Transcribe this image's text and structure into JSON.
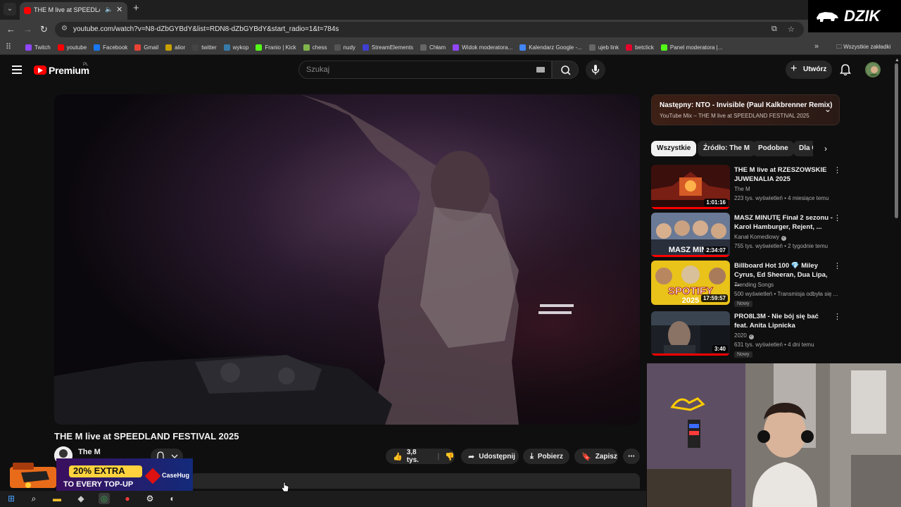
{
  "browser": {
    "tab_title": "THE M live at SPEEDLAND F",
    "url": "youtube.com/watch?v=N8-dZbGYBdY&list=RDN8-dZbGYBdY&start_radio=1&t=784s",
    "bookmarks": [
      {
        "label": "Twitch",
        "icon": "twitch-icon",
        "color": "#9146ff"
      },
      {
        "label": "youtube",
        "icon": "youtube-icon",
        "color": "#ff0000"
      },
      {
        "label": "Facebook",
        "icon": "facebook-icon",
        "color": "#1877f2"
      },
      {
        "label": "Gmail",
        "icon": "gmail-icon",
        "color": "#ea4335"
      },
      {
        "label": "alior",
        "icon": "alior-icon",
        "color": "#c8a000"
      },
      {
        "label": "twitter",
        "icon": "x-icon",
        "color": "#444444"
      },
      {
        "label": "wykop",
        "icon": "wykop-icon",
        "color": "#367aa9"
      },
      {
        "label": "Franio | Kick",
        "icon": "kick-icon",
        "color": "#53fc18"
      },
      {
        "label": "chess",
        "icon": "chess-icon",
        "color": "#81b64c"
      },
      {
        "label": "nudy",
        "icon": "folder-icon",
        "color": "#555555"
      },
      {
        "label": "StreamElements",
        "icon": "streamelements-icon",
        "color": "#3f3fd1"
      },
      {
        "label": "Chłam",
        "icon": "globe-icon",
        "color": "#666666"
      },
      {
        "label": "Widok moderatora...",
        "icon": "twitch-icon",
        "color": "#9146ff"
      },
      {
        "label": "Kalendarz Google -...",
        "icon": "calendar-icon",
        "color": "#4285f4"
      },
      {
        "label": "ujeb link",
        "icon": "globe-icon",
        "color": "#666666"
      },
      {
        "label": "betclick",
        "icon": "betclic-icon",
        "color": "#e5002b"
      },
      {
        "label": "Panel moderatora |...",
        "icon": "kick-icon",
        "color": "#53fc18"
      }
    ],
    "all_bookmarks": "Wszystkie zakładki"
  },
  "overlay_logo": "DZIK",
  "youtube": {
    "brand": "Premium",
    "country": "PL",
    "search_placeholder": "Szukaj",
    "create_label": "Utwórz"
  },
  "video": {
    "title": "THE M live at SPEEDLAND FESTIVAL 2025",
    "channel": "The M",
    "likes": "3,8 tys.",
    "share": "Udostępnij",
    "download": "Pobierz",
    "save": "Zapisz"
  },
  "up_next": {
    "title": "Następny: NTO - Invisible (Paul Kalkbrenner Remix)",
    "subtitle": "YouTube Mix – THE M live at SPEEDLAND FESTIVAL 2025"
  },
  "chips": [
    "Wszystkie",
    "Źródło: The M",
    "Podobne",
    "Dla C"
  ],
  "recommendations": [
    {
      "title": "THE M live at RZESZOWSKIE JUWENALIA 2025",
      "channel": "The M",
      "meta": "223 tys. wyświetleń • 4 miesiące temu",
      "duration": "1:01:16",
      "badge": "",
      "progress": 1.0,
      "verified": false
    },
    {
      "title": "MASZ MINUTĘ Finał 2 sezonu - Karol Hamburger, Rejent, ...",
      "channel": "Kanał Komediowy",
      "meta": "755 tys. wyświetleń • 2 tygodnie temu",
      "duration": "2:34:07",
      "badge": "",
      "progress": 1.0,
      "verified": true
    },
    {
      "title": "Billboard Hot 100 💎 Miley Cyrus, Ed Sheeran, Dua Lipa, ...",
      "channel": "Trending Songs",
      "meta": "500 wyświetleń • Transmisja odbyła się ...",
      "duration": "17:59:57",
      "badge": "Nowy",
      "progress": 0.0,
      "verified": false
    },
    {
      "title": "PRO8L3M - Nie bój się bać feat. Anita Lipnicka",
      "channel": "2020",
      "meta": "631 tys. wyświetleń • 4 dni temu",
      "duration": "3:40",
      "badge": "Nowy",
      "progress": 1.0,
      "verified": true
    }
  ],
  "ad": {
    "headline": "20% EXTRA",
    "subline": "TO EVERY TOP-UP",
    "brand": "CaseHug"
  }
}
